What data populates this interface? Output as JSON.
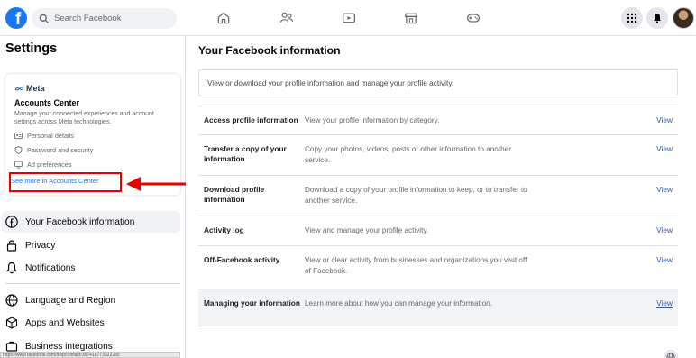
{
  "header": {
    "logo": "f",
    "search_placeholder": "Search Facebook",
    "nav_icons": [
      "home-icon",
      "friends-icon",
      "watch-icon",
      "marketplace-icon",
      "gaming-icon"
    ],
    "right_icons": [
      "menu-grid-icon",
      "notifications-bell-icon",
      "avatar"
    ]
  },
  "sidebar": {
    "title": "Settings",
    "accounts_center": {
      "brand": "Meta",
      "title": "Accounts Center",
      "description": "Manage your connected experiences and account settings across Meta technologies.",
      "items": [
        {
          "label": "Personal details",
          "icon": "id-card-icon"
        },
        {
          "label": "Password and security",
          "icon": "shield-icon"
        },
        {
          "label": "Ad preferences",
          "icon": "monitor-icon"
        }
      ],
      "link": "See more in Accounts Center"
    },
    "items": [
      {
        "label": "Your Facebook information",
        "icon": "facebook-icon",
        "active": true
      },
      {
        "label": "Privacy",
        "icon": "lock-icon"
      },
      {
        "label": "Notifications",
        "icon": "bell-icon"
      },
      {
        "label": "Language and Region",
        "icon": "globe-icon"
      },
      {
        "label": "Apps and Websites",
        "icon": "cube-icon"
      },
      {
        "label": "Business integrations",
        "icon": "briefcase-icon"
      }
    ],
    "status_url": "https://www.facebook.com/help/contact/367418773322280"
  },
  "main": {
    "title": "Your Facebook information",
    "intro": "View or download your profile information and manage your profile activity.",
    "rows": [
      {
        "label": "Access profile information",
        "desc": "View your profile information by category.",
        "action": "View"
      },
      {
        "label": "Transfer a copy of your information",
        "desc": "Copy your photos, videos, posts or other information to another service.",
        "action": "View"
      },
      {
        "label": "Download profile information",
        "desc": "Download a copy of your profile information to keep, or to transfer to another service.",
        "action": "View"
      },
      {
        "label": "Activity log",
        "desc": "View and manage your profile activity.",
        "action": "View"
      },
      {
        "label": "Off-Facebook activity",
        "desc": "View or clear activity from businesses and organizations you visit off of Facebook.",
        "action": "View"
      },
      {
        "label": "Managing your information",
        "desc": "Learn more about how you can manage your information.",
        "action": "View"
      }
    ]
  },
  "colors": {
    "brand": "#1877f2",
    "link": "#385898",
    "highlight_box": "#e60000"
  }
}
